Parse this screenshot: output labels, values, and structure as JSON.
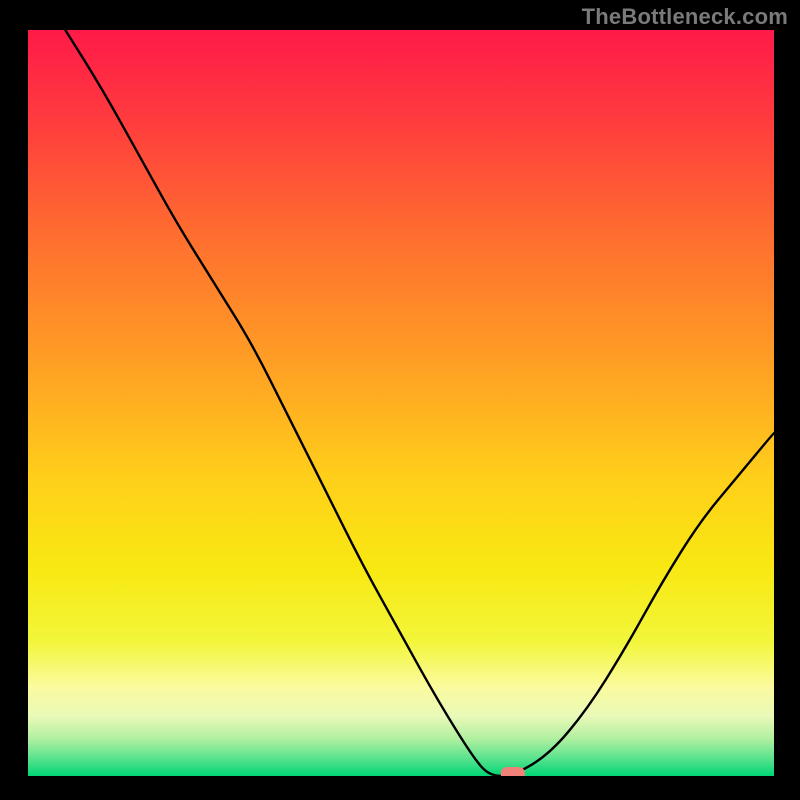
{
  "watermark": {
    "text": "TheBottleneck.com"
  },
  "chart_data": {
    "type": "line",
    "title": "",
    "xlabel": "",
    "ylabel": "",
    "xlim": [
      0,
      100
    ],
    "ylim": [
      0,
      100
    ],
    "series": [
      {
        "name": "bottleneck-curve",
        "x": [
          5,
          10,
          15,
          20,
          25,
          30,
          35,
          40,
          45,
          50,
          55,
          60,
          62,
          65,
          70,
          75,
          80,
          85,
          90,
          95,
          100
        ],
        "values": [
          100,
          92,
          83,
          74,
          66,
          58,
          48,
          38,
          28,
          19,
          10,
          2,
          0,
          0,
          3,
          9,
          17,
          26,
          34,
          40,
          46
        ]
      }
    ],
    "marker": {
      "name": "optimal-point",
      "x": 65,
      "y": 0,
      "color": "#f08078"
    },
    "gradient_bands": [
      {
        "y": 100,
        "color": "#ff1744"
      },
      {
        "y": 85,
        "color": "#ff4a3a"
      },
      {
        "y": 70,
        "color": "#ff7a2f"
      },
      {
        "y": 55,
        "color": "#ffa323"
      },
      {
        "y": 40,
        "color": "#ffcf1a"
      },
      {
        "y": 30,
        "color": "#f6e913"
      },
      {
        "y": 20,
        "color": "#e8f75a"
      },
      {
        "y": 12,
        "color": "#fdfda6"
      },
      {
        "y": 6,
        "color": "#b7f5a0"
      },
      {
        "y": 2,
        "color": "#24e27e"
      },
      {
        "y": 0,
        "color": "#00d872"
      }
    ]
  }
}
